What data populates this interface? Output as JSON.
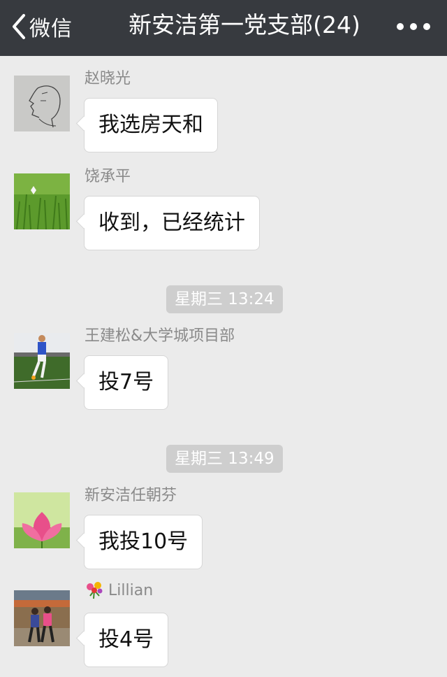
{
  "header": {
    "back_label": "微信",
    "title": "新安洁第一党支部(24)",
    "back_icon": "chevron-left-icon",
    "more_icon": "more-dots-icon"
  },
  "timestamps": [
    "星期三 13:24",
    "星期三 13:49"
  ],
  "messages": [
    {
      "sender": "赵晓光",
      "text": "我选房天和"
    },
    {
      "sender": "饶承平",
      "text": "收到，已经统计"
    },
    {
      "sender": "王建松&大学城项目部",
      "text": "投7号"
    },
    {
      "sender": "新安洁任朝芬",
      "text": "我投10号"
    },
    {
      "sender": "Lillian",
      "text": "投4号",
      "sender_icon": "flower-emoji-icon"
    }
  ],
  "colors": {
    "header_bg": "#373a3f",
    "chat_bg": "#ebebeb",
    "bubble_bg": "#ffffff",
    "timestamp_bg": "#cecece",
    "sender_text": "#8a8a8a"
  }
}
